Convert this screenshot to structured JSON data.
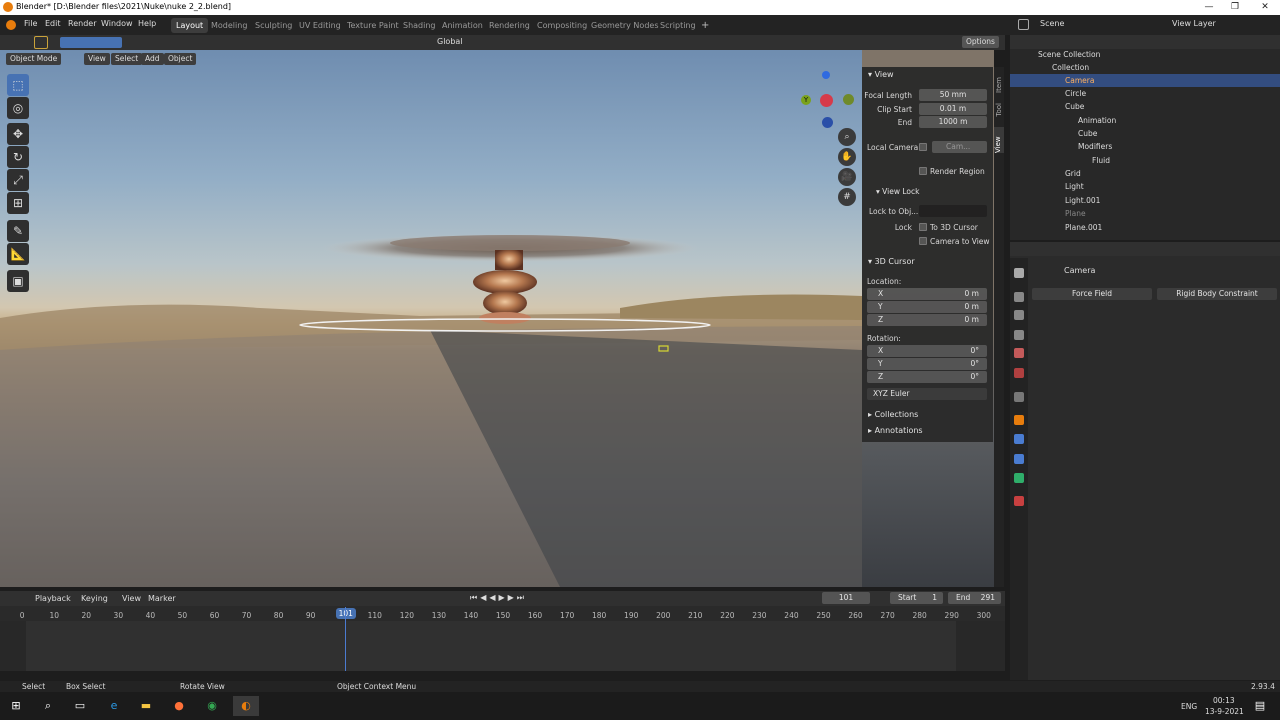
{
  "window": {
    "title": "Blender* [D:\\Blender files\\2021\\Nuke\\nuke 2_2.blend]",
    "min": "—",
    "max": "❐",
    "close": "✕"
  },
  "menu": [
    "File",
    "Edit",
    "Render",
    "Window",
    "Help"
  ],
  "workspaces": [
    "Layout",
    "Modeling",
    "Sculpting",
    "UV Editing",
    "Texture Paint",
    "Shading",
    "Animation",
    "Rendering",
    "Compositing",
    "Geometry Nodes",
    "Scripting"
  ],
  "active_workspace": "Layout",
  "scene": {
    "name": "Scene",
    "view_layer": "View Layer"
  },
  "toolhdr": {
    "orientation": "Global",
    "options": "Options"
  },
  "viewport_header": {
    "mode": "Object Mode",
    "view": "View",
    "select": "Select",
    "add": "Add",
    "object": "Object"
  },
  "npanel": {
    "tabs": [
      "Item",
      "Tool",
      "View"
    ],
    "view": {
      "title": "View",
      "focal_label": "Focal Length",
      "focal": "50 mm",
      "clip_start_label": "Clip Start",
      "clip_start": "0.01 m",
      "end_label": "End",
      "end": "1000 m",
      "local_camera": "Local Camera",
      "camera_field": "Cam...",
      "render_region": "Render Region"
    },
    "view_lock": {
      "title": "View Lock",
      "lock_to_obj": "Lock to Obj...",
      "lock": "Lock",
      "to_3d_cursor": "To 3D Cursor",
      "camera_to_view": "Camera to View"
    },
    "cursor": {
      "title": "3D Cursor",
      "location": "Location:",
      "x": "X",
      "y": "Y",
      "z": "Z",
      "lx": "0 m",
      "ly": "0 m",
      "lz": "0 m",
      "rotation": "Rotation:",
      "rx": "0°",
      "ry": "0°",
      "rz": "0°",
      "mode": "XYZ Euler"
    },
    "collections": "Collections",
    "annotations": "Annotations"
  },
  "gizmo": {
    "y": "Y",
    "z": "Z"
  },
  "timeline": {
    "playback": "Playback",
    "keying": "Keying",
    "view": "View",
    "marker": "Marker",
    "frame": "101",
    "start_label": "Start",
    "start": "1",
    "end_label": "End",
    "end": "291",
    "ticks": [
      "0",
      "10",
      "20",
      "30",
      "40",
      "50",
      "60",
      "70",
      "80",
      "90",
      "101",
      "110",
      "120",
      "130",
      "140",
      "150",
      "160",
      "170",
      "180",
      "190",
      "200",
      "210",
      "220",
      "230",
      "240",
      "250",
      "260",
      "270",
      "280",
      "290",
      "300"
    ]
  },
  "outliner": {
    "rows": [
      {
        "label": "Scene Collection"
      },
      {
        "label": "Collection"
      },
      {
        "label": "Camera",
        "selected": true
      },
      {
        "label": "Circle"
      },
      {
        "label": "Cube"
      },
      {
        "label": "Animation"
      },
      {
        "label": "Cube"
      },
      {
        "label": "Modifiers"
      },
      {
        "label": "Fluid"
      },
      {
        "label": "Grid"
      },
      {
        "label": "Light"
      },
      {
        "label": "Light.001"
      },
      {
        "label": "Plane"
      },
      {
        "label": "Plane.001"
      }
    ]
  },
  "properties": {
    "object": "Camera",
    "force_field": "Force Field",
    "rigid_body_constraint": "Rigid Body Constraint"
  },
  "status": {
    "select": "Select",
    "box_select": "Box Select",
    "rotate": "Rotate View",
    "context": "Object Context Menu",
    "version": "2.93.4"
  },
  "taskbar": {
    "lang": "ENG",
    "time": "00:13",
    "date": "13-9-2021"
  }
}
